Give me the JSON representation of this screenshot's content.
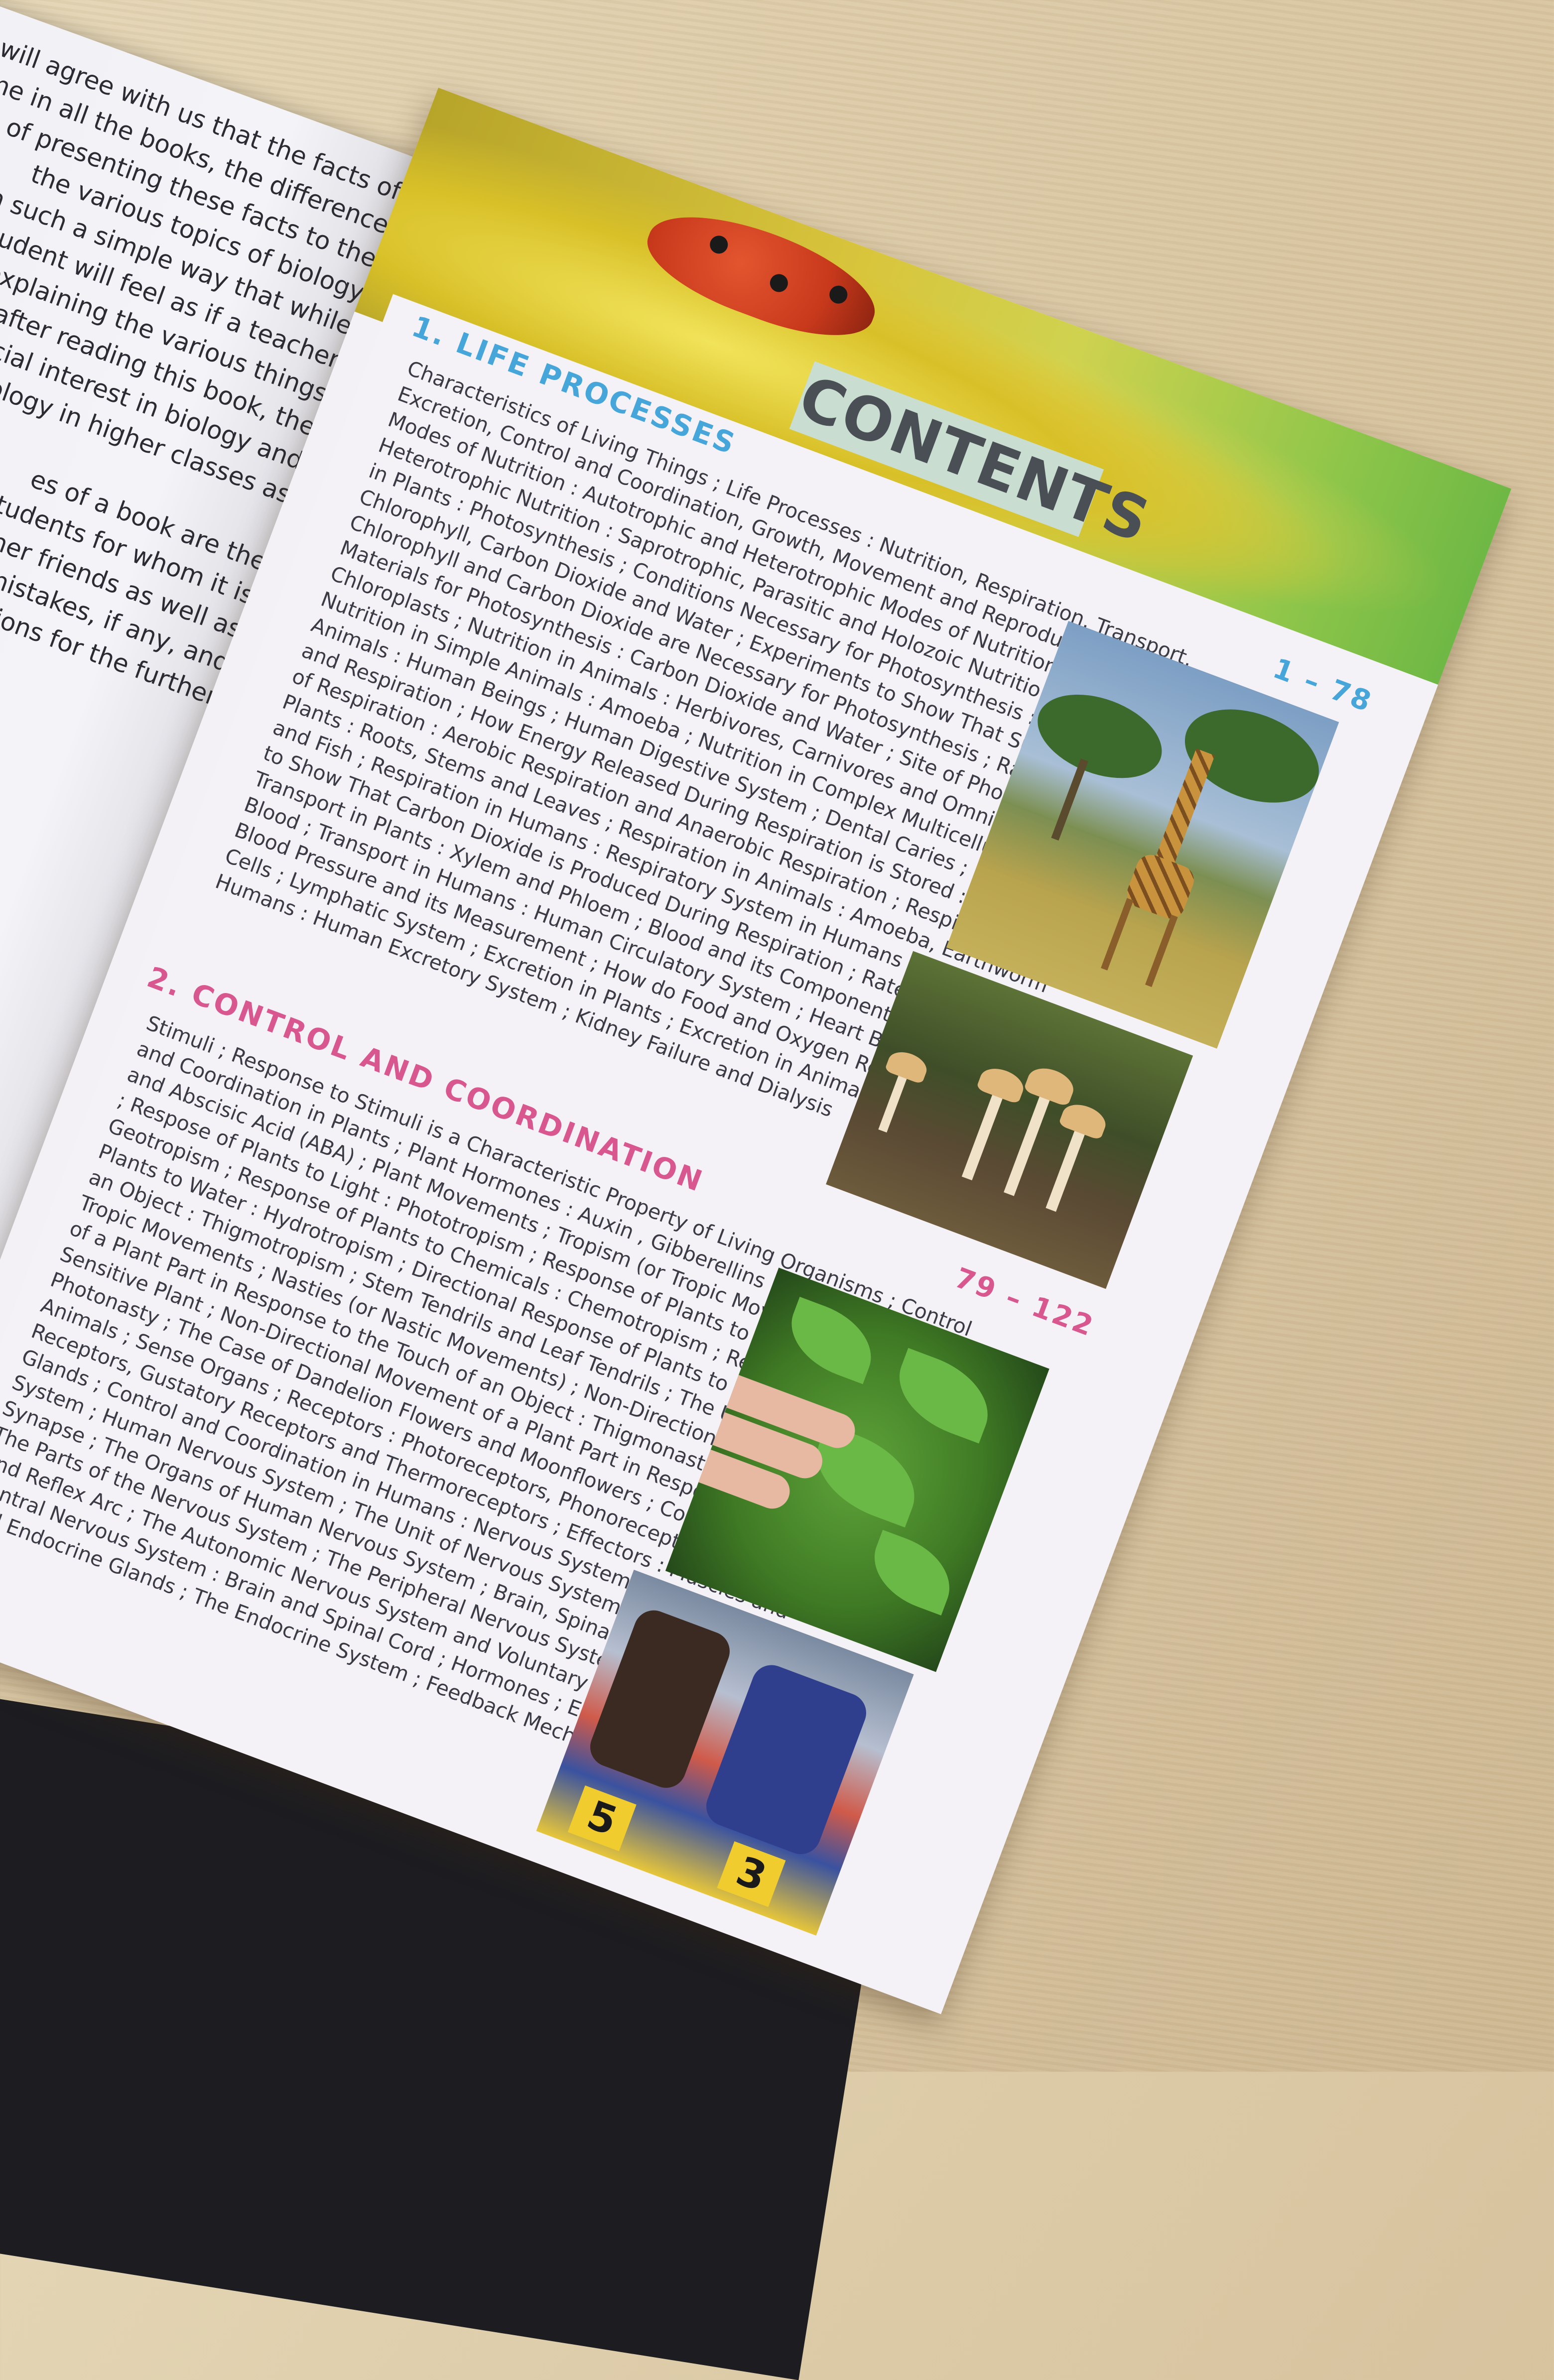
{
  "left_page": {
    "paragraphs": [
      [
        "will agree with us that the facts of",
        "same in all the books, the difference",
        "of presenting these facts to the",
        "the various topics of biology",
        "in such a simple way that while",
        "student will feel as if a teacher",
        "explaining the various things",
        "after reading this book, the",
        "special interest in biology and",
        "biology in higher classes as"
      ],
      [
        "es of a book are the",
        "students for whom it is",
        "cher friends as well as",
        "mistakes, if any, and",
        "stions for the further"
      ]
    ]
  },
  "header": {
    "title": "CONTENTS"
  },
  "sections": [
    {
      "heading": "1. LIFE PROCESSES",
      "pages": "1 – 78",
      "lines": [
        "Characteristics of Living Things ; Life Processes : Nutrition, Respiration, Transport,",
        "Excretion, Control and Coordination, Growth, Movement and Reproduction ;",
        "Modes of Nutrition : Autotrophic and Heterotrophic Modes of Nutrition ; Types of",
        "Heterotrophic Nutrition : Saprotrophic, Parasitic and Holozoic Nutrition ; Nutrition",
        "in Plants : Photosynthesis ; Conditions Necessary for Photosynthesis : Sunlight,",
        "Chlorophyll, Carbon Dioxide and Water ; Experiments to Show That Sunlight,",
        "Chlorophyll and Carbon Dioxide are Necessary for Photosynthesis ; Raw",
        "Materials for Photosynthesis : Carbon Dioxide and Water ; Site of Photosynthesis :",
        "Chloroplasts ; Nutrition in Animals : Herbivores, Carnivores and Omnivores ;",
        "Nutrition in Simple Animals : Amoeba ; Nutrition in Complex Multicellular",
        "Animals : Human Beings ; Human Digestive System ; Dental Caries ; Breathing",
        "and Respiration ; How Energy Released During Respiration is Stored : ATP ; Types",
        "of Respiration : Aerobic Respiration and Anaerobic Respiration ; Respiration in",
        "Plants : Roots, Stems and Leaves ; Respiration in Animals : Amoeba, Earthworm",
        "and Fish ; Respiration in Humans : Respiratory System in Humans ; Experiment",
        "to Show That Carbon Dioxide is Produced During Respiration ; Rate of Breathing ;",
        "Transport in Plants : Xylem and Phloem ; Blood and its Components ; Functions of",
        "Blood ; Transport in Humans : Human Circulatory System ; Heart Beats and Pulse ;",
        "Blood Pressure and its Measurement ; How do Food and Oxygen Reach Body",
        "Cells ; Lymphatic System ; Excretion in Plants ; Excretion in Animals ; Excretion in",
        "Humans : Human Excretory System ; Kidney Failure and Dialysis"
      ]
    },
    {
      "heading": "2. CONTROL AND COORDINATION",
      "pages": "79 – 122",
      "lines": [
        "Stimuli ; Response to Stimuli is a Characteristic Property of Living Organisms ; Control",
        "and Coordination in Plants ; Plant Hormones : Auxin , Gibberellins ; Cytokinins",
        "and Abscisic Acid (ABA) ; Plant Movements ; Tropism (or Tropic Movements)",
        "; Respose of Plants to Light : Phototropism ; Response of Plants to Gravity :",
        "Geotropism ; Response of Plants to Chemicals : Chemotropism ; Response of",
        "Plants to Water : Hydrotropism ; Directional Response of Plants to the Touch of",
        "an Object : Thigmotropism ; Stem Tendrils and Leaf Tendrils ; The Usefulness of",
        "Tropic Movements ; Nasties (or Nastic Movements) ; Non-Directional Movement",
        "of a Plant Part in Response to the Touch of an Object : Thigmonasty ; The Case of",
        "Sensitive Plant ; Non-Directional Movement of a Plant Part in Response to Light :",
        "Photonasty ; The Case of Dandelion Flowers and Moonflowers ; Coordination in",
        "Animals ; Sense Organs ; Receptors : Photoreceptors, Phonoreceptors, Olfactory",
        "Receptors, Gustatory Receptors and Thermoreceptors ; Effectors : Muscles and",
        "Glands ; Control and Coordination in Humans : Nervous System and Endocrine",
        "System ; Human Nervous System ; The Unit of Nervous System : Neuron ;",
        "Synapse ; The Organs of Human Nervous System ; Brain, Spinal Cord and Nerves ;",
        "The Parts of the Nervous System ; The Peripheral Nervous System ; Reflex Action",
        "and Reflex Arc ; The Autonomic Nervous System and Voluntary Nervous System ;",
        "Central Nervous System : Brain and Spinal Cord ; Hormones ; Exocrine Glands",
        "and Endocrine Glands ; The Endocrine System ; Feedback Mechanism"
      ]
    }
  ],
  "photos": {
    "runner_bib_left": "5",
    "runner_bib_right": "3"
  }
}
